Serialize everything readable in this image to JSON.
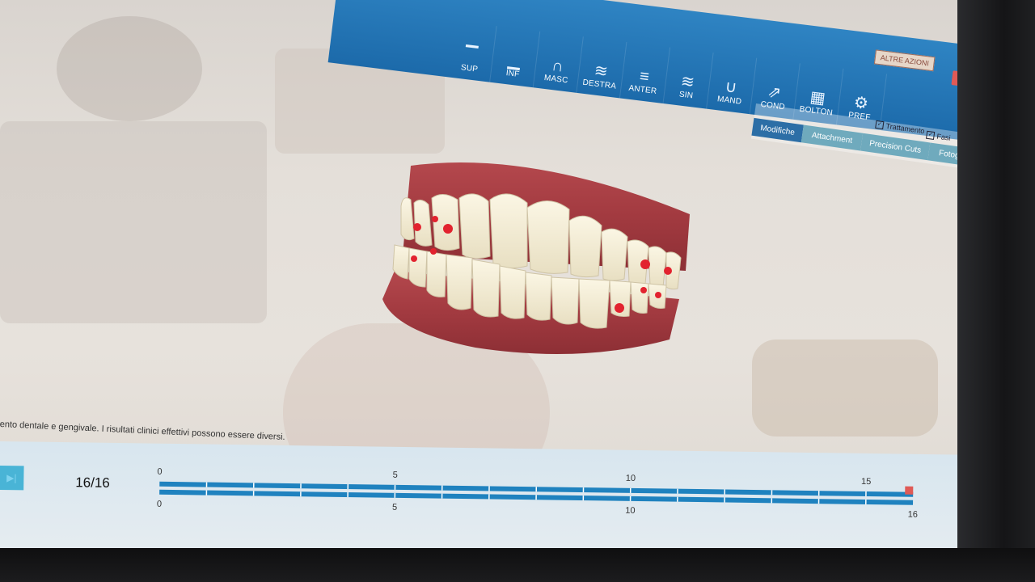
{
  "toolbar": {
    "items": [
      {
        "label": "SUP",
        "icon": "arrow-up-icon"
      },
      {
        "label": "INF",
        "icon": "arrow-down-icon"
      },
      {
        "label": "MASC",
        "icon": "arc-icon"
      },
      {
        "label": "DESTRA",
        "icon": "right-view-icon"
      },
      {
        "label": "ANTER",
        "icon": "front-view-icon"
      },
      {
        "label": "SIN",
        "icon": "left-view-icon"
      },
      {
        "label": "MAND",
        "icon": "jaw-icon"
      },
      {
        "label": "COND",
        "icon": "share-icon"
      },
      {
        "label": "BOLTON",
        "icon": "calculator-icon"
      },
      {
        "label": "PREF",
        "icon": "gear-icon"
      }
    ]
  },
  "header": {
    "altre_azioni": "ALTRE AZIONI",
    "colors": {
      "toolbar": "#1c6aaa",
      "accent": "#2c6ea6",
      "danger": "#e05a56"
    }
  },
  "tabs": {
    "items": [
      "Modifiche",
      "Attachment",
      "Precision Cuts",
      "Fotografie"
    ],
    "active": "Modifiche",
    "trattamento_label": "Trattamento",
    "fasi_label": "Fasi"
  },
  "disclaimer": "ento dentale e gengivale. I risultati clinici effettivi possono essere diversi.",
  "player": {
    "stage_counter": "16/16",
    "upper_ticks": [
      "0",
      "5",
      "10",
      "15"
    ],
    "lower_ticks": [
      "0",
      "5",
      "10",
      "16"
    ],
    "current_stage": 16,
    "total_stages": 16
  }
}
